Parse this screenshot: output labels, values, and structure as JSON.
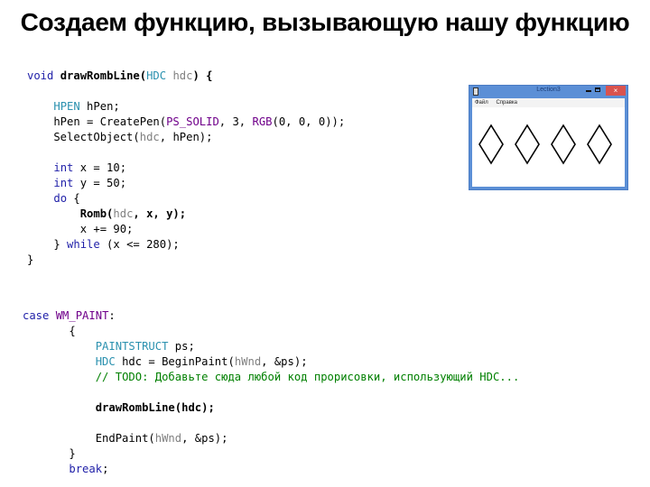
{
  "slide": {
    "title": "Создаем функцию, вызывающую нашу функцию"
  },
  "code_block_1": {
    "lines": [
      [
        {
          "t": "void",
          "c": "kw"
        },
        {
          "t": " "
        },
        {
          "t": "drawRombLine(",
          "c": "b"
        },
        {
          "t": "HDC",
          "c": "ty"
        },
        {
          "t": " "
        },
        {
          "t": "hdc",
          "c": "par"
        },
        {
          "t": ") {",
          "c": "b"
        }
      ],
      [],
      [
        {
          "t": "    "
        },
        {
          "t": "HPEN",
          "c": "ty"
        },
        {
          "t": " hPen;"
        }
      ],
      [
        {
          "t": "    hPen = CreatePen("
        },
        {
          "t": "PS_SOLID",
          "c": "mac"
        },
        {
          "t": ", 3, "
        },
        {
          "t": "RGB",
          "c": "mac"
        },
        {
          "t": "(0, 0, 0));"
        }
      ],
      [
        {
          "t": "    SelectObject("
        },
        {
          "t": "hdc",
          "c": "par"
        },
        {
          "t": ", hPen);"
        }
      ],
      [],
      [
        {
          "t": "    "
        },
        {
          "t": "int",
          "c": "kw"
        },
        {
          "t": " x = 10;"
        }
      ],
      [
        {
          "t": "    "
        },
        {
          "t": "int",
          "c": "kw"
        },
        {
          "t": " y = 50;"
        }
      ],
      [
        {
          "t": "    "
        },
        {
          "t": "do",
          "c": "kw"
        },
        {
          "t": " {"
        }
      ],
      [
        {
          "t": "        "
        },
        {
          "t": "Romb(",
          "c": "b"
        },
        {
          "t": "hdc",
          "c": "par"
        },
        {
          "t": ", x, y);",
          "c": "b"
        }
      ],
      [
        {
          "t": "        x += 90;"
        }
      ],
      [
        {
          "t": "    } "
        },
        {
          "t": "while",
          "c": "kw"
        },
        {
          "t": " (x <= 280);"
        }
      ],
      [
        {
          "t": "}"
        }
      ]
    ]
  },
  "code_block_2": {
    "lines": [
      [
        {
          "t": "case",
          "c": "kw"
        },
        {
          "t": " "
        },
        {
          "t": "WM_PAINT",
          "c": "mac"
        },
        {
          "t": ":"
        }
      ],
      [
        {
          "t": "       {"
        }
      ],
      [
        {
          "t": "           "
        },
        {
          "t": "PAINTSTRUCT",
          "c": "ty"
        },
        {
          "t": " ps;"
        }
      ],
      [
        {
          "t": "           "
        },
        {
          "t": "HDC",
          "c": "ty"
        },
        {
          "t": " hdc = BeginPaint("
        },
        {
          "t": "hWnd",
          "c": "par"
        },
        {
          "t": ", &ps);"
        }
      ],
      [
        {
          "t": "           "
        },
        {
          "t": "// TODO: Добавьте сюда любой код прорисовки, использующий HDC...",
          "c": "cmt"
        }
      ],
      [],
      [
        {
          "t": "           "
        },
        {
          "t": "drawRombLine(hdc);",
          "c": "b"
        }
      ],
      [],
      [
        {
          "t": "           EndPaint("
        },
        {
          "t": "hWnd",
          "c": "par"
        },
        {
          "t": ", &ps);"
        }
      ],
      [
        {
          "t": "       }"
        }
      ],
      [
        {
          "t": "       "
        },
        {
          "t": "break",
          "c": "kw"
        },
        {
          "t": ";"
        }
      ]
    ]
  },
  "preview_window": {
    "title": "Lection3",
    "menu": [
      "Файл",
      "Справка"
    ],
    "close_glyph": "×",
    "rhombus_count": 4
  }
}
